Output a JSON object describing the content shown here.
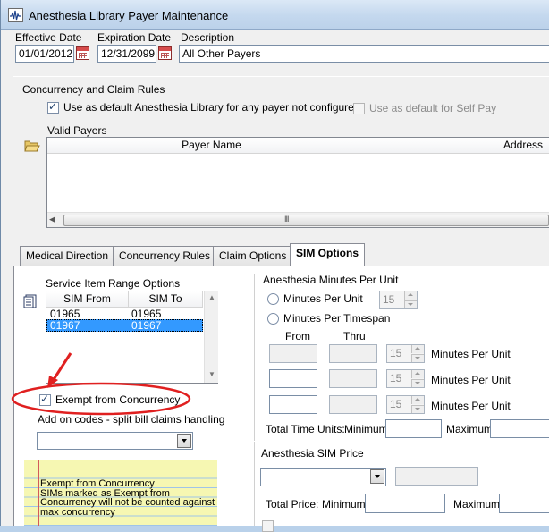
{
  "window": {
    "title": "Anesthesia Library Payer Maintenance"
  },
  "header": {
    "effective_date_label": "Effective Date",
    "effective_date_value": "01/01/2012",
    "expiration_date_label": "Expiration Date",
    "expiration_date_value": "12/31/2099",
    "description_label": "Description",
    "description_value": "All Other Payers"
  },
  "rules": {
    "group_label": "Concurrency and Claim Rules",
    "default_any_payer_label": "Use as default Anesthesia Library for any payer not configured",
    "default_any_payer_checked": true,
    "default_self_pay_label": "Use as default for Self Pay",
    "default_self_pay_checked": false,
    "valid_payers_label": "Valid Payers",
    "payers_columns": [
      "Payer Name",
      "Address"
    ],
    "scroll_grip": "III"
  },
  "tabs": [
    {
      "label": "Medical Direction",
      "active": false
    },
    {
      "label": "Concurrency Rules",
      "active": false
    },
    {
      "label": "Claim Options",
      "active": false
    },
    {
      "label": "SIM Options",
      "active": true
    }
  ],
  "sim": {
    "range_label": "Service Item Range Options",
    "columns": [
      "SIM From",
      "SIM To"
    ],
    "rows": [
      {
        "from": "01965",
        "to": "01965",
        "selected": false
      },
      {
        "from": "01967",
        "to": "01967",
        "selected": true
      }
    ],
    "exempt_label": "Exempt from Concurrency",
    "exempt_checked": true,
    "addon_label": "Add on codes - split bill claims handling",
    "addon_value": ""
  },
  "note": {
    "title": "Exempt from Concurrency",
    "body": "SIMs marked as Exempt from Concurrency will not be counted against max concurrency"
  },
  "minutes": {
    "group_label": "Anesthesia Minutes Per Unit",
    "per_unit_label": "Minutes Per Unit",
    "per_unit_value": "15",
    "per_timespan_label": "Minutes Per Timespan",
    "from_label": "From",
    "thru_label": "Thru",
    "rows": [
      {
        "value": "15",
        "unit_label": "Minutes Per Unit"
      },
      {
        "value": "15",
        "unit_label": "Minutes Per Unit"
      },
      {
        "value": "15",
        "unit_label": "Minutes Per Unit"
      }
    ],
    "total_label": "Total Time Units:",
    "minimum_label": "Minimum",
    "maximum_label": "Maximum"
  },
  "price": {
    "group_label": "Anesthesia SIM Price",
    "total_label": "Total Price:",
    "minimum_label": "Minimum",
    "maximum_label": "Maximum"
  },
  "colors": {
    "selection": "#3399ff",
    "annotation": "#e02020",
    "note_bg": "#f6f7b2"
  }
}
